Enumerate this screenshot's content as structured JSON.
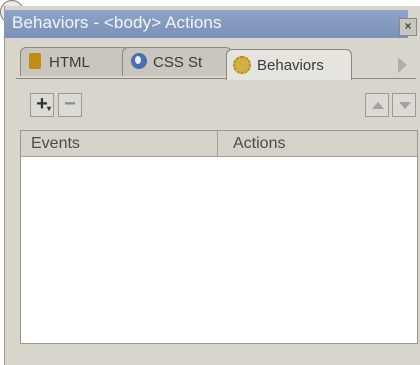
{
  "window": {
    "title": "Behaviors - <body> Actions",
    "close_symbol": "×"
  },
  "tabs": [
    {
      "label": "HTML",
      "icon": "paragraph-icon"
    },
    {
      "label": "CSS St",
      "icon": "globe-icon"
    },
    {
      "label": "Behaviors",
      "icon": "gear-icon",
      "active": true
    }
  ],
  "help_label": "?",
  "toolbar": {
    "add_label": "+",
    "add_caret": "▾",
    "remove_label": "−"
  },
  "list": {
    "columns": [
      "Events",
      "Actions"
    ],
    "rows": []
  }
}
